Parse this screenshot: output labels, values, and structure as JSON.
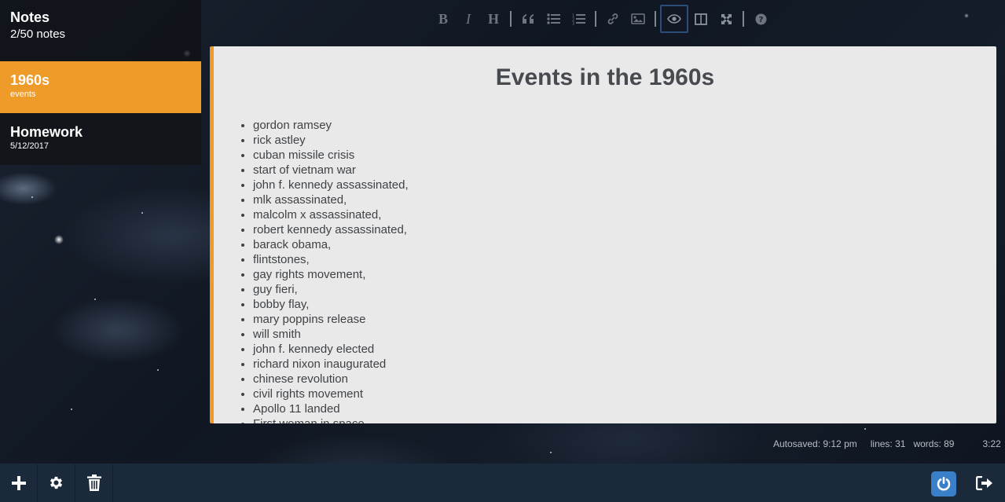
{
  "sidebar": {
    "title": "Notes",
    "count": "2/50 notes",
    "notes": [
      {
        "title": "1960s",
        "subtitle": "events"
      },
      {
        "title": "Homework",
        "subtitle": "5/12/2017"
      }
    ]
  },
  "toolbar": {
    "bold": "B",
    "italic": "I",
    "heading": "H",
    "icons": [
      "bold-icon",
      "italic-icon",
      "heading-icon",
      "quote-icon",
      "unordered-list-icon",
      "ordered-list-icon",
      "link-icon",
      "image-icon",
      "preview-icon",
      "side-by-side-icon",
      "fullscreen-icon",
      "help-icon"
    ],
    "active": "preview-icon"
  },
  "editor": {
    "title": "Events in the 1960s",
    "items": [
      "gordon ramsey",
      "rick astley",
      "cuban missile crisis",
      "start of vietnam war",
      "john f. kennedy assassinated,",
      "mlk assassinated,",
      "malcolm x assassinated,",
      "robert kennedy assassinated,",
      "barack obama,",
      "flintstones,",
      "gay rights movement,",
      "guy fieri,",
      "bobby flay,",
      "mary poppins release",
      "will smith",
      "john f. kennedy elected",
      "richard nixon inaugurated",
      "chinese revolution",
      "civil rights movement",
      "Apollo 11 landed",
      "First woman in space"
    ]
  },
  "status": {
    "autosaved": "Autosaved: 9:12 pm",
    "lines": "lines: 31",
    "words": "words: 89",
    "cursor": "3:22"
  },
  "bottombar": {
    "icons": [
      "add-icon",
      "settings-icon",
      "trash-icon",
      "power-icon",
      "logout-icon"
    ]
  },
  "colors": {
    "accent": "#ef9b2a",
    "bottombar": "#1b2a3a",
    "power_button": "#3a80c8",
    "editor_bg": "#e9e9e9"
  }
}
